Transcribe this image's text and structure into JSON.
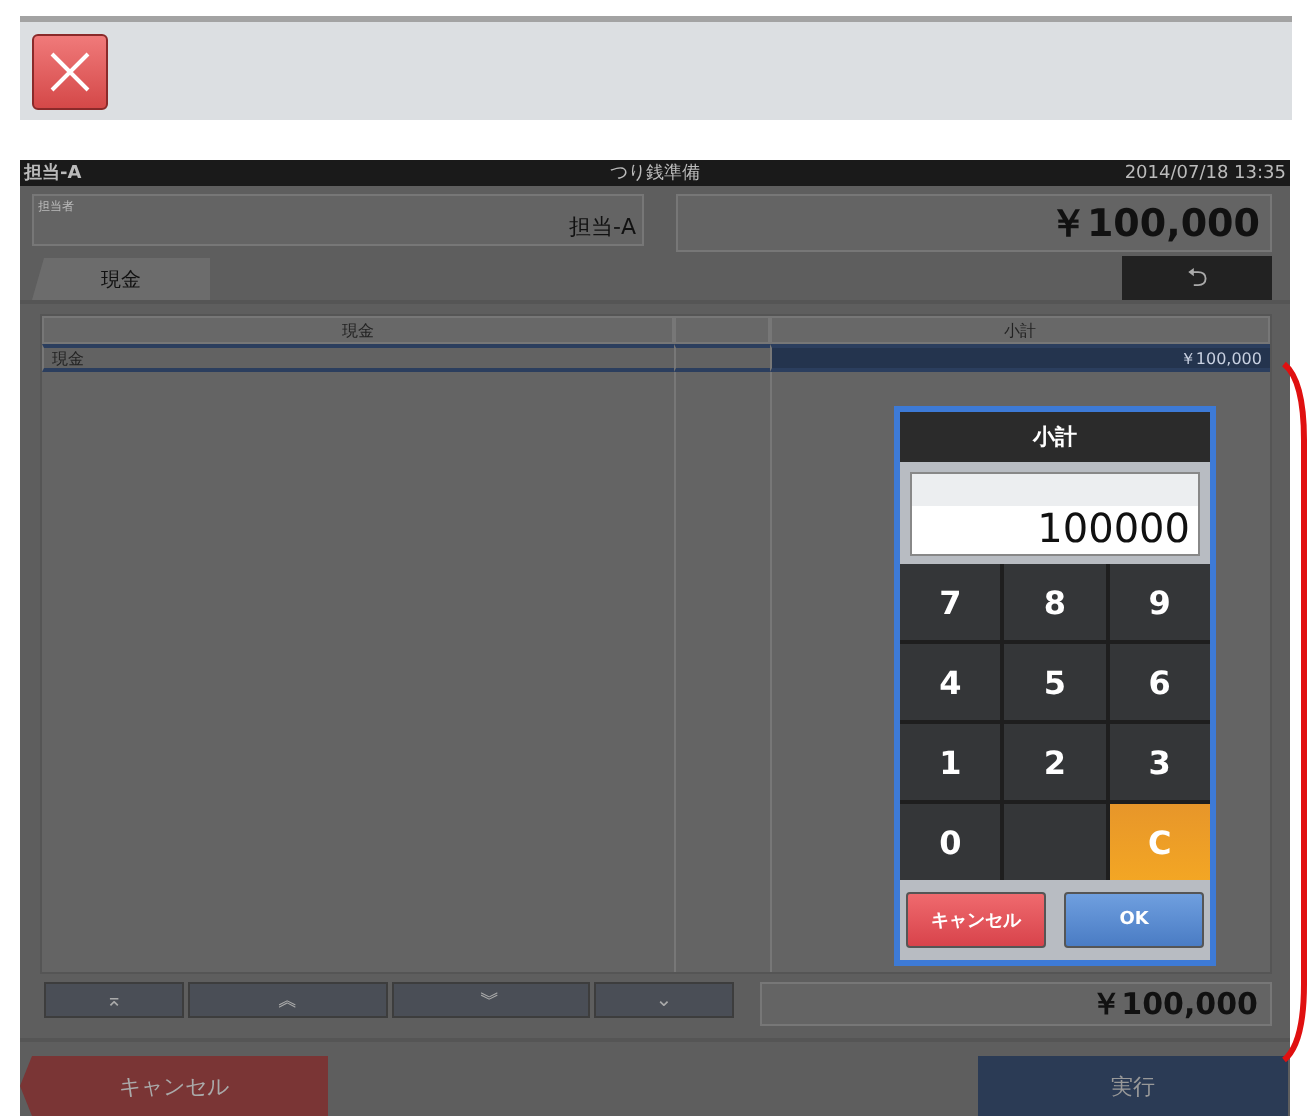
{
  "header": {
    "staff_label": "担当-A",
    "title": "つり銭準備",
    "datetime": "2014/07/18 13:35"
  },
  "staff": {
    "label": "担当者",
    "value": "担当-A"
  },
  "total": "￥100,000",
  "tabs": [
    {
      "label": "現金",
      "selected": true
    }
  ],
  "back_button": "⮌",
  "table": {
    "columns": [
      "現金",
      "",
      "小計"
    ],
    "rows": [
      {
        "cells": [
          "現金",
          "",
          "￥100,000"
        ],
        "selected": true
      }
    ]
  },
  "nav_buttons": [
    "⌅",
    "︽",
    "︾",
    "⌄"
  ],
  "footer_total": "￥100,000",
  "cancel_button": "キャンセル",
  "execute_button": "実行",
  "keypad": {
    "title": "小計",
    "value": "100000",
    "keys": [
      {
        "label": "7",
        "kind": "digit"
      },
      {
        "label": "8",
        "kind": "digit"
      },
      {
        "label": "9",
        "kind": "digit"
      },
      {
        "label": "4",
        "kind": "digit"
      },
      {
        "label": "5",
        "kind": "digit"
      },
      {
        "label": "6",
        "kind": "digit"
      },
      {
        "label": "1",
        "kind": "digit"
      },
      {
        "label": "2",
        "kind": "digit"
      },
      {
        "label": "3",
        "kind": "digit"
      },
      {
        "label": "0",
        "kind": "digit"
      },
      {
        "kind": "blank"
      },
      {
        "label": "C",
        "kind": "clear"
      }
    ],
    "cancel": "キャンセル",
    "ok": "OK"
  }
}
